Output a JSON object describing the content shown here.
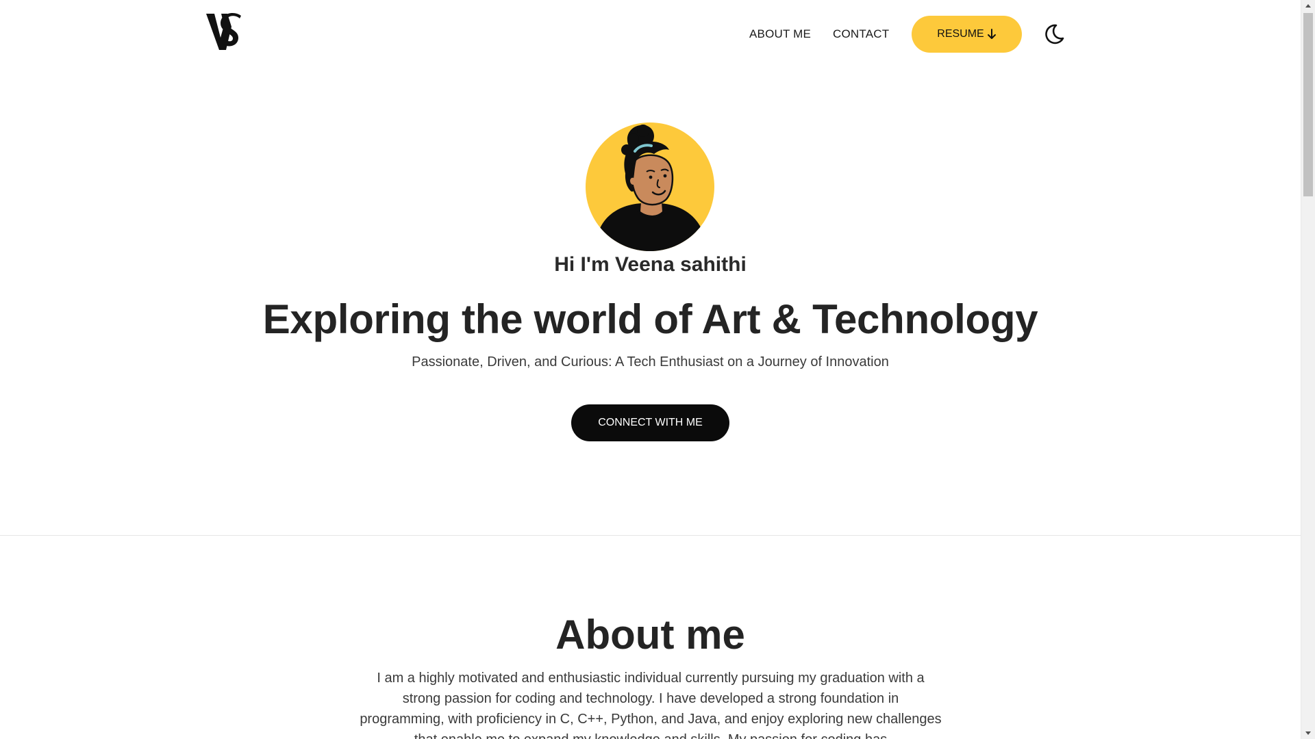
{
  "header": {
    "logo_text": "VS",
    "nav": {
      "about_label": "ABOUT ME",
      "contact_label": "CONTACT"
    },
    "resume_label": "RESUME",
    "resume_icon": "arrow-down-icon",
    "theme_toggle_icon": "moon-icon"
  },
  "hero": {
    "avatar_icon": "avatar-illustration",
    "greeting": "Hi I'm Veena sahithi",
    "headline": "Exploring the world of Art & Technology",
    "subline": "Passionate, Driven, and Curious: A Tech Enthusiast on a Journey of Innovation",
    "cta_label": "CONNECT WITH ME"
  },
  "about": {
    "title": "About me",
    "body": "I am a highly motivated and enthusiastic individual currently pursuing my graduation with a strong passion for coding and technology. I have developed a strong foundation in programming, with proficiency in C, C++, Python, and Java, and enjoy exploring new challenges that enable me to expand my knowledge and skills. My passion for coding has"
  },
  "colors": {
    "accent": "#fdc93b",
    "button_dark": "#0b0b0b",
    "text": "#242424",
    "background": "#ffffff"
  }
}
